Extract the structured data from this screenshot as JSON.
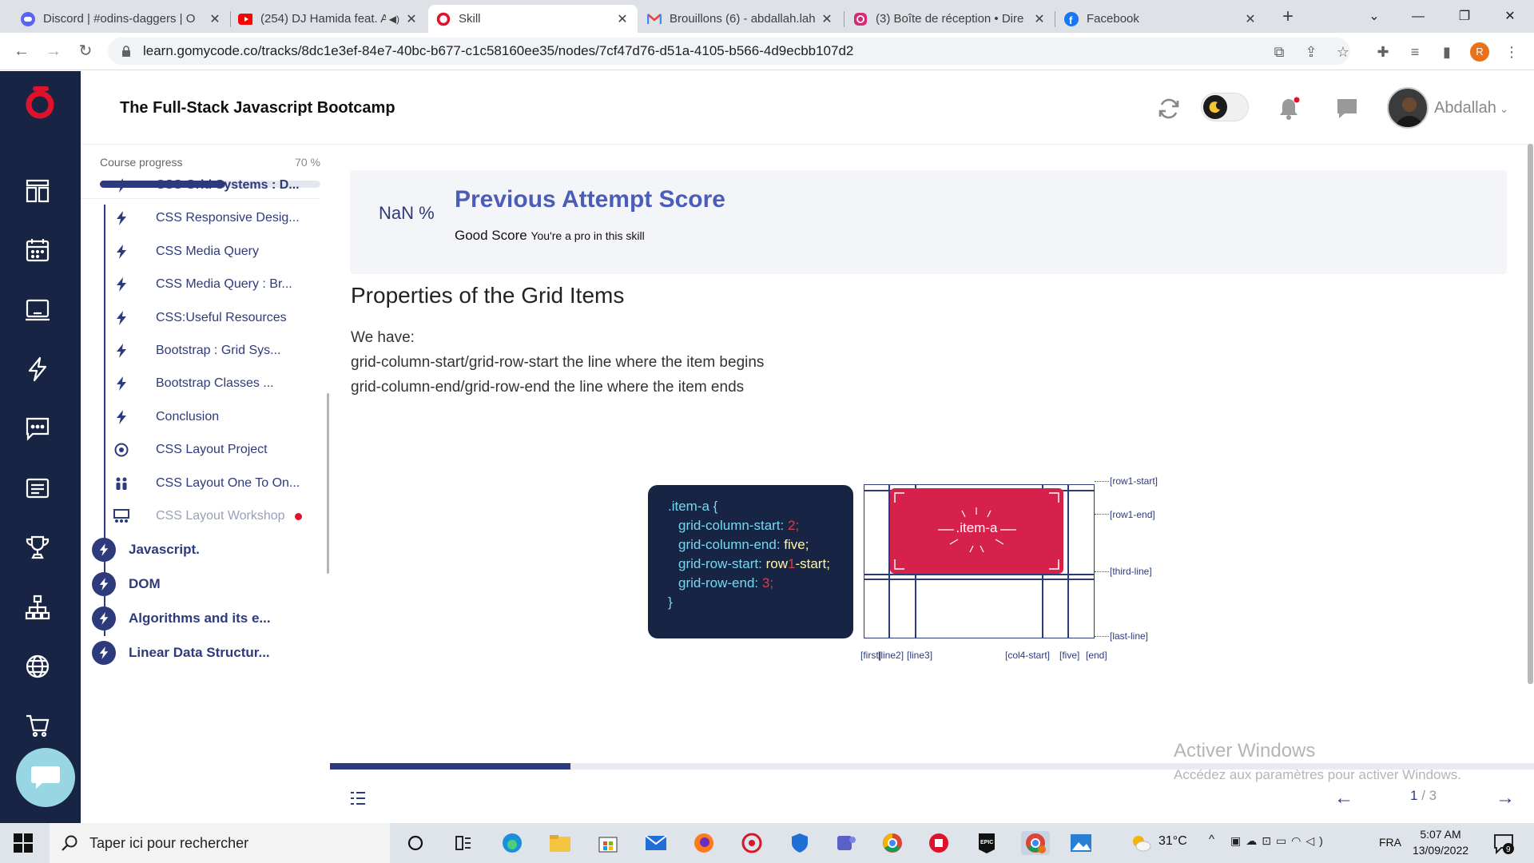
{
  "browser": {
    "tabs": [
      {
        "title": "Discord | #odins-daggers | O",
        "icon": "discord-icon",
        "color": "#5865f2"
      },
      {
        "title": "(254) DJ Hamida feat. A",
        "icon": "youtube-icon",
        "color": "#ff0000"
      },
      {
        "title": "Skill",
        "icon": "gomycode-icon",
        "color": "#e0122b",
        "active": true
      },
      {
        "title": "Brouillons (6) - abdallah.lah",
        "icon": "gmail-icon",
        "color": "#ea4335"
      },
      {
        "title": "(3) Boîte de réception • Dire",
        "icon": "instagram-icon",
        "color": "#d62976"
      },
      {
        "title": "Facebook",
        "icon": "facebook-icon",
        "color": "#1877f2"
      }
    ],
    "new_tab": "+",
    "url": "learn.gomycode.co/tracks/8dc1e3ef-84e7-40bc-b677-c1c58160ee35/nodes/7cf47d76-d51a-4105-b566-4d9ecbb107d2",
    "profile_initial": "R"
  },
  "header": {
    "course_title": "The Full-Stack Javascript Bootcamp",
    "username": "Abdallah"
  },
  "sidebar": {
    "progress_label": "Course progress",
    "progress_text": "70 %",
    "progress_value": 0.57,
    "lessons": [
      {
        "label": "CSS Grid Systems : D...",
        "icon": "bolt-icon",
        "current": true
      },
      {
        "label": "CSS Responsive Desig...",
        "icon": "bolt-icon"
      },
      {
        "label": "CSS Media Query",
        "icon": "bolt-icon"
      },
      {
        "label": "CSS Media Query : Br...",
        "icon": "bolt-icon"
      },
      {
        "label": "CSS:Useful Resources",
        "icon": "bolt-icon"
      },
      {
        "label": "Bootstrap : Grid Sys...",
        "icon": "bolt-icon"
      },
      {
        "label": "Bootstrap Classes ...",
        "icon": "bolt-icon"
      },
      {
        "label": "Conclusion",
        "icon": "bolt-icon"
      },
      {
        "label": "CSS Layout Project",
        "icon": "target-icon"
      },
      {
        "label": "CSS Layout One To On...",
        "icon": "people-icon"
      },
      {
        "label": "CSS Layout Workshop",
        "icon": "workshop-icon",
        "dim": true,
        "new": true
      }
    ],
    "modules": [
      {
        "label": "Javascript."
      },
      {
        "label": "DOM"
      },
      {
        "label": "Algorithms and its e..."
      },
      {
        "label": "Linear Data Structur..."
      }
    ]
  },
  "score": {
    "percent": "NaN %",
    "title": "Previous Attempt Score",
    "grade": "Good Score",
    "message": "You're a pro in this skill"
  },
  "content": {
    "title": "Properties of the Grid Items",
    "lines": [
      "We have:",
      "grid-column-start/grid-row-start the line where the item begins",
      "grid-column-end/grid-row-end the line where the item ends"
    ]
  },
  "diagram": {
    "code": {
      "selector": ".item-a {",
      "p1": "grid-column-start:",
      "v1": "2",
      "p2": "grid-column-end:",
      "v2": "five",
      "p3": "grid-row-start:",
      "v3a": "row",
      "v3b": "1",
      "v3c": "-start",
      "p4": "grid-row-end:",
      "v4": "3",
      "semi": ";",
      "close": "}"
    },
    "item_label": ".item-a",
    "row_labels": [
      "[row1-start]",
      "[row1-end]",
      "[third-line]",
      "[last-line]"
    ],
    "col_labels": [
      "[first]",
      "[line2]",
      "[line3]",
      "[col4-start]",
      "[five]",
      "[end]"
    ]
  },
  "pager": {
    "current": "1",
    "sep": " / ",
    "total": "3",
    "progress_value": 0.2
  },
  "watermark": {
    "title": "Activer Windows",
    "subtitle": "Accédez aux paramètres pour activer Windows."
  },
  "taskbar": {
    "search_placeholder": "Taper ici pour rechercher",
    "weather": "31°C",
    "language": "FRA",
    "time": "5:07 AM",
    "date": "13/09/2022",
    "notification_count": "9"
  }
}
